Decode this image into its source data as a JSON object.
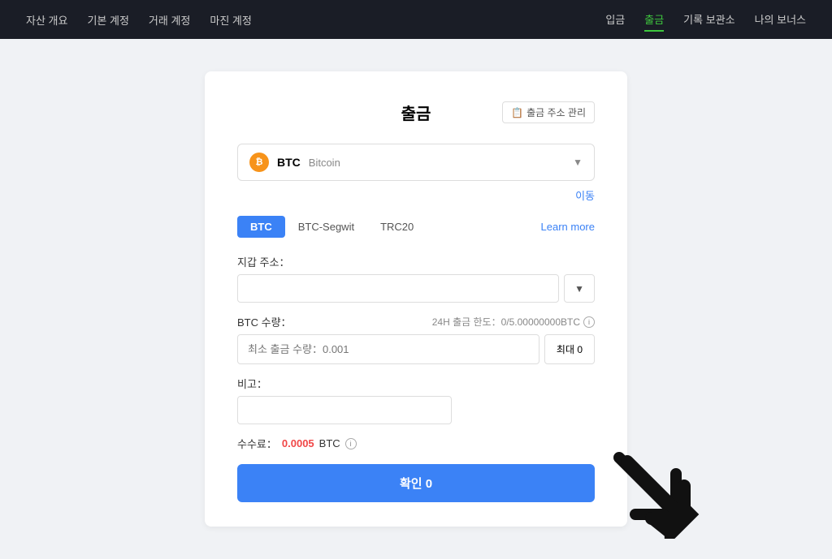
{
  "nav": {
    "left_items": [
      {
        "label": "자산 개요",
        "active": false
      },
      {
        "label": "기본 계정",
        "active": false
      },
      {
        "label": "거래 계정",
        "active": false
      },
      {
        "label": "마진 계정",
        "active": false
      }
    ],
    "right_items": [
      {
        "label": "입금",
        "active": false
      },
      {
        "label": "출금",
        "active": true
      },
      {
        "label": "기록 보관소",
        "active": false
      },
      {
        "label": "나의 보너스",
        "active": false
      }
    ]
  },
  "page": {
    "title": "출금",
    "manage_btn_label": "출금 주소 관리",
    "coin": {
      "symbol": "BTC",
      "name": "Bitcoin"
    },
    "transfer_link": "이동",
    "network_tabs": [
      {
        "label": "BTC",
        "active": true
      },
      {
        "label": "BTC-Segwit",
        "active": false
      },
      {
        "label": "TRC20",
        "active": false
      }
    ],
    "learn_more": "Learn more",
    "address_label": "지갑 주소：",
    "amount_label": "BTC 수량：",
    "amount_placeholder": "최소 출금 수량：0.001",
    "limit_label": "24H 출금 한도：0/5.00000000BTC",
    "max_btn_label": "최대 0",
    "memo_label": "비고：",
    "fee_label": "수수료：",
    "fee_value": "0.0005",
    "fee_unit": "BTC",
    "confirm_btn_label": "확인 0"
  }
}
